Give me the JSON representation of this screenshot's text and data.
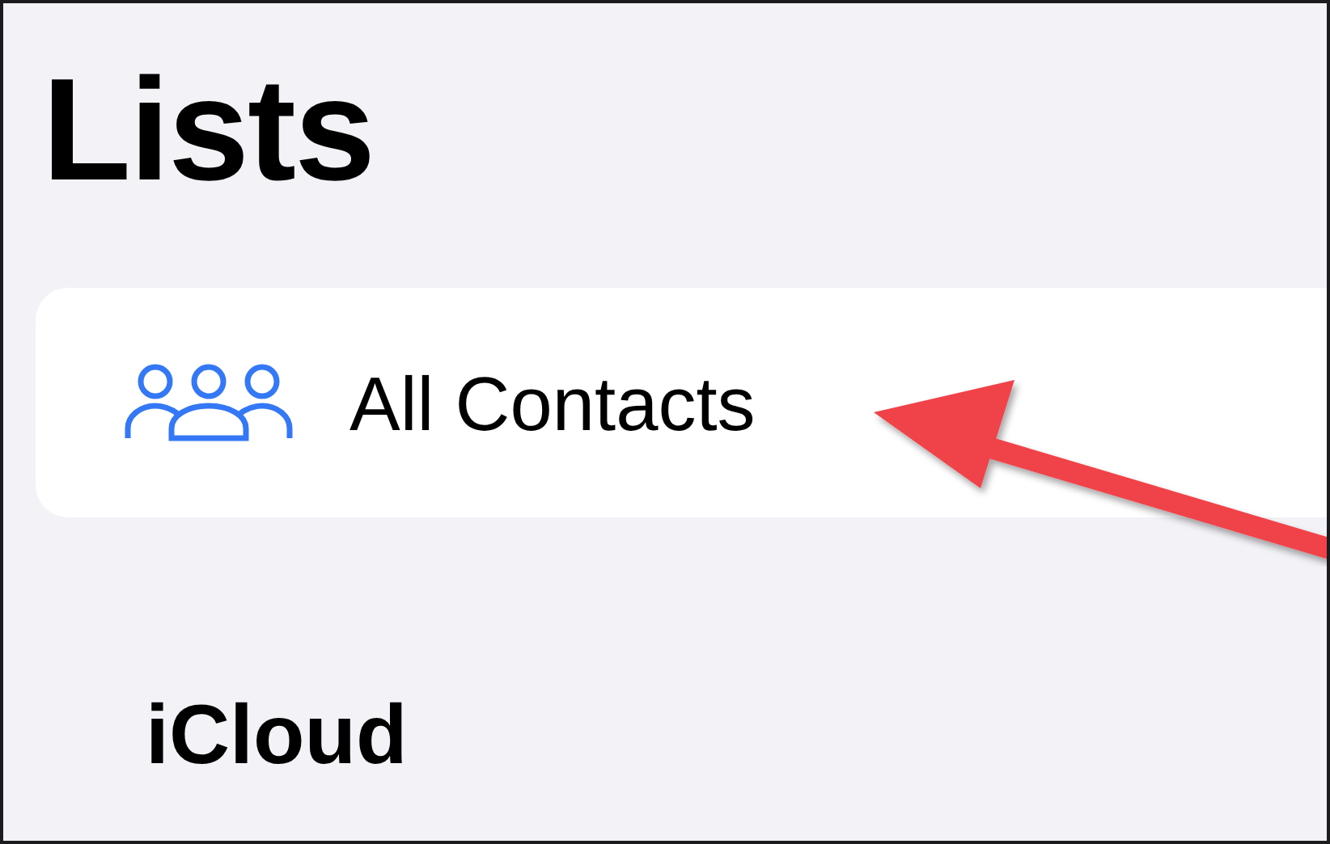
{
  "title": "Lists",
  "items": [
    {
      "label": "All Contacts",
      "kind": "group"
    }
  ],
  "sections": [
    {
      "title": "iCloud"
    }
  ]
}
